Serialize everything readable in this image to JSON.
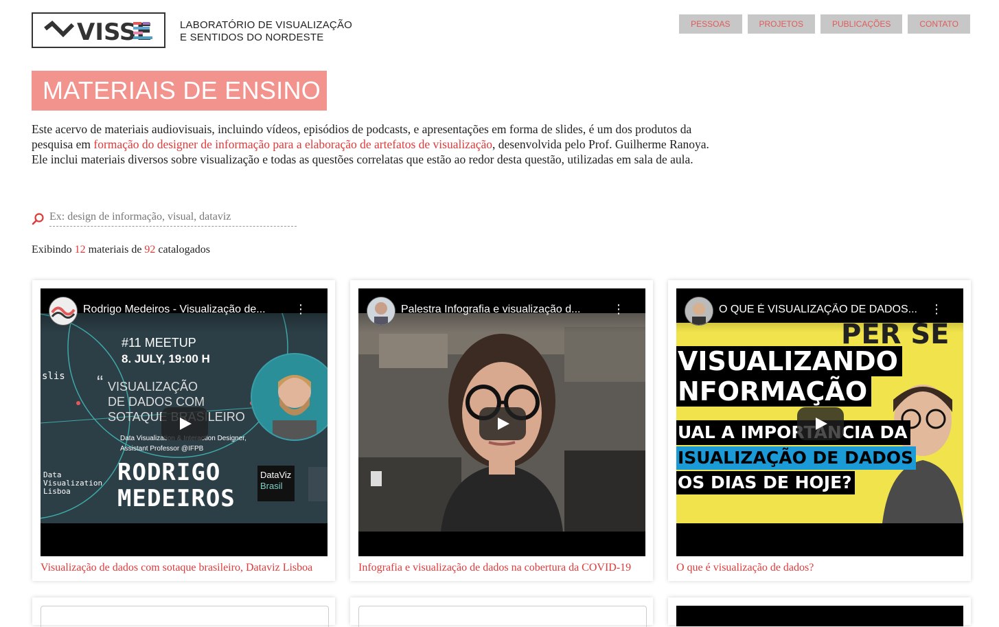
{
  "header": {
    "logo_text": "VISSE",
    "lab_name_line1": "LABORATÓRIO DE VISUALIZAÇÃO",
    "lab_name_line2": "E SENTIDOS DO NORDESTE"
  },
  "nav": [
    {
      "label": "PESSOAS"
    },
    {
      "label": "PROJETOS"
    },
    {
      "label": "PUBLICAÇÕES"
    },
    {
      "label": "CONTATO"
    }
  ],
  "page": {
    "title": "MATERIAIS DE ENSINO",
    "intro_before": "Este acervo de materiais audiovisuais, incluindo vídeos, episódios de podcasts, e apresentações em forma de slides, é um dos produtos da pesquisa em ",
    "intro_link": "formação do designer de informação para a elaboração de artefatos de visualização",
    "intro_after": ", desenvolvida pelo Prof. Guilherme Ranoya. Ele inclui materiais diversos sobre visualização e todas as questões correlatas que estão ao redor desta questão, utilizadas em sala de aula."
  },
  "search": {
    "placeholder": "Ex: design de informação, visual, dataviz"
  },
  "count": {
    "prefix": "Exibindo",
    "shown": "12",
    "middle": "materiais de",
    "total": "92",
    "suffix": "catalogados"
  },
  "colors": {
    "accent": "#f3938d",
    "link": "#e03a3a",
    "nav_bg": "#c7c7c7"
  },
  "cards": [
    {
      "video_title": "Rodrigo Medeiros - Visualização de...",
      "caption": "Visualização de dados com sotaque brasileiro, Dataviz Lisboa",
      "thumb": {
        "meetup": "#11 MEETUP",
        "date": "8. JULY, 19:00 H",
        "quote_mark": "“",
        "quote_line1": "VISUALIZAÇÃO",
        "quote_line2": "DE DADOS COM",
        "quote_line3": "SOTAQUE BRASILEIRO",
        "role_line1": "Data Visualization & Interaction Designer,",
        "role_line2": "Assistant Professor @IFPB",
        "name_line1": "RODRIGO",
        "name_line2": "MEDEIROS",
        "side_line1": "Data",
        "side_line2": "Visualization",
        "side_line3": "Lisboa",
        "lis": "slis",
        "dv_line1": "DataViz",
        "dv_line2": "Brasil"
      }
    },
    {
      "video_title": "Palestra Infografia e visualização d...",
      "caption": "Infografia e visualização de dados na cobertura da COVID-19"
    },
    {
      "video_title": "O QUE É VISUALIZAÇÃO DE DADOS...",
      "caption": "O que é visualização de dados?",
      "thumb": {
        "top": "PER SE",
        "line1": "VISUALIZANDO",
        "line2": "NFORMAÇÃO",
        "line3": "UAL A IMPORTÂNCIA DA",
        "line4": "ISUALIZAÇÃO DE DADOS",
        "line5": "OS DIAS DE HOJE?"
      }
    }
  ]
}
